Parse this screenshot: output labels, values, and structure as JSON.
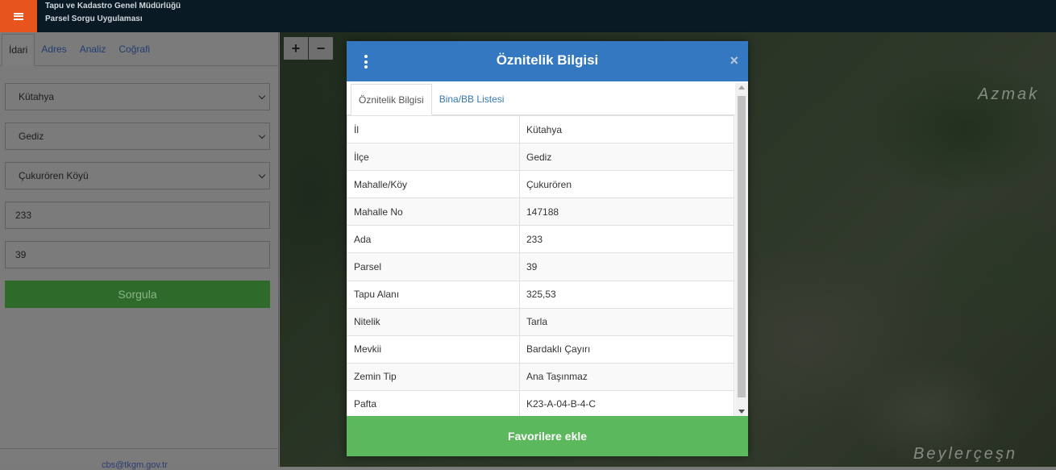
{
  "header": {
    "title_line1": "Tapu ve Kadastro Genel Müdürlüğü",
    "title_line2": "Parsel Sorgu Uygulaması"
  },
  "sidebar": {
    "tabs": [
      {
        "label": "İdari",
        "active": true
      },
      {
        "label": "Adres",
        "active": false
      },
      {
        "label": "Analiz",
        "active": false
      },
      {
        "label": "Coğrafi",
        "active": false
      }
    ],
    "il_select": "Kütahya",
    "ilce_select": "Gediz",
    "mahalle_select": "Çukurören Köyü",
    "ada_input": "233",
    "parsel_input": "39",
    "submit_label": "Sorgula",
    "footer_email": "cbs@tkgm.gov.tr"
  },
  "map": {
    "controls": [
      "+",
      "−"
    ],
    "labels": [
      "Azmak",
      "Beylerçeşn"
    ]
  },
  "modal": {
    "title": "Öznitelik Bilgisi",
    "close": "×",
    "tabs": [
      {
        "label": "Öznitelik Bilgisi",
        "active": true
      },
      {
        "label": "Bina/BB Listesi",
        "active": false
      }
    ],
    "rows": [
      {
        "key": "İl",
        "value": "Kütahya"
      },
      {
        "key": "İlçe",
        "value": "Gediz"
      },
      {
        "key": "Mahalle/Köy",
        "value": "Çukurören"
      },
      {
        "key": "Mahalle No",
        "value": "147188"
      },
      {
        "key": "Ada",
        "value": "233"
      },
      {
        "key": "Parsel",
        "value": "39"
      },
      {
        "key": "Tapu Alanı",
        "value": "325,53"
      },
      {
        "key": "Nitelik",
        "value": "Tarla"
      },
      {
        "key": "Mevkii",
        "value": "Bardaklı Çayırı"
      },
      {
        "key": "Zemin Tip",
        "value": "Ana Taşınmaz"
      },
      {
        "key": "Pafta",
        "value": "K23-A-04-B-4-C"
      }
    ],
    "favorite_button": "Favorilere ekle"
  },
  "colors": {
    "header_bg": "#0a1a24",
    "menu_accent": "#e8541e",
    "modal_header": "#3478c1",
    "favorite_green": "#5cb85c",
    "submit_green": "#2e6b2b"
  }
}
